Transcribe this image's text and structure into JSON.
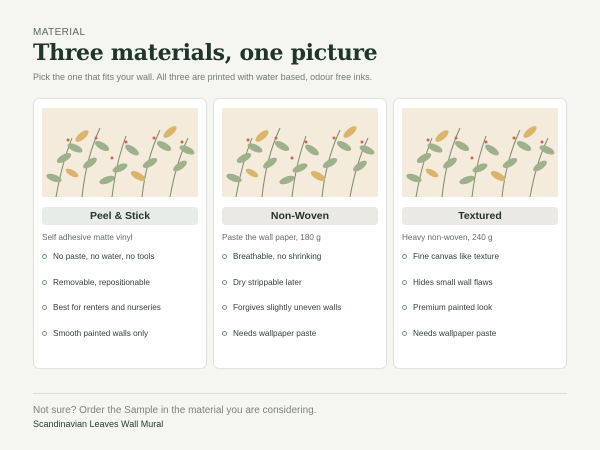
{
  "header": {
    "eyebrow": "MATERIAL",
    "title": "Three materials, one picture",
    "subtitle": "Pick the one that fits your wall. All three are printed with water based, odour free inks."
  },
  "materials": [
    {
      "name": "Peel & Stick",
      "pill_color": "#e7ece8",
      "description": "Self adhesive matte vinyl",
      "features": [
        "No paste, no water, no tools",
        "Removable, repositionable",
        "Best for renters and nurseries",
        "Smooth painted walls only"
      ]
    },
    {
      "name": "Non-Woven",
      "pill_color": "#ebe9e4",
      "description": "Paste the wall paper, 180 g",
      "features": [
        "Breathable, no shrinking",
        "Dry strippable later",
        "Forgives slightly uneven walls",
        "Needs wallpaper paste"
      ]
    },
    {
      "name": "Textured",
      "pill_color": "#ebe9e4",
      "description": "Heavy non-woven, 240 g",
      "features": [
        "Fine canvas like texture",
        "Hides small wall flaws",
        "Premium painted look",
        "Needs wallpaper paste"
      ]
    }
  ],
  "icons": {
    "bullet": "circle-bullet-icon"
  },
  "footer": {
    "note": "Not sure? Order the Sample in the material you are considering.",
    "product_name": "Scandinavian Leaves Wall Mural"
  }
}
